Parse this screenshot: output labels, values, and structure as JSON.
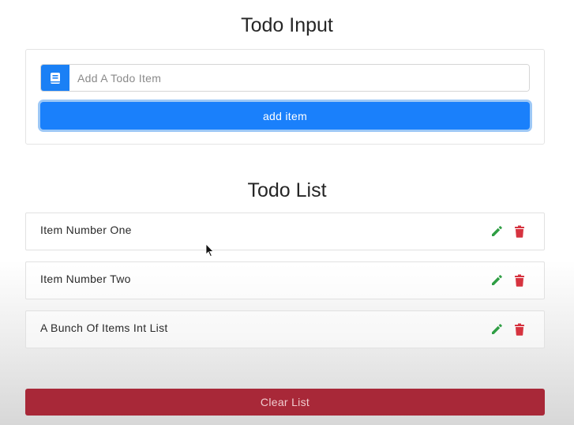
{
  "input_section": {
    "title": "Todo Input",
    "placeholder": "Add A Todo Item",
    "value": "",
    "add_button_label": "add item",
    "prepend_icon": "book-icon"
  },
  "list_section": {
    "title": "Todo List",
    "items": [
      {
        "label": "Item Number One"
      },
      {
        "label": "Item Number Two"
      },
      {
        "label": "A Bunch Of Items Int List"
      }
    ],
    "edit_icon": "pencil-icon",
    "delete_icon": "trash-icon"
  },
  "clear_button_label": "Clear List",
  "colors": {
    "primary": "#1a80fb",
    "edit": "#2f9e44",
    "delete": "#d6333f",
    "danger_button": "#a82838"
  }
}
